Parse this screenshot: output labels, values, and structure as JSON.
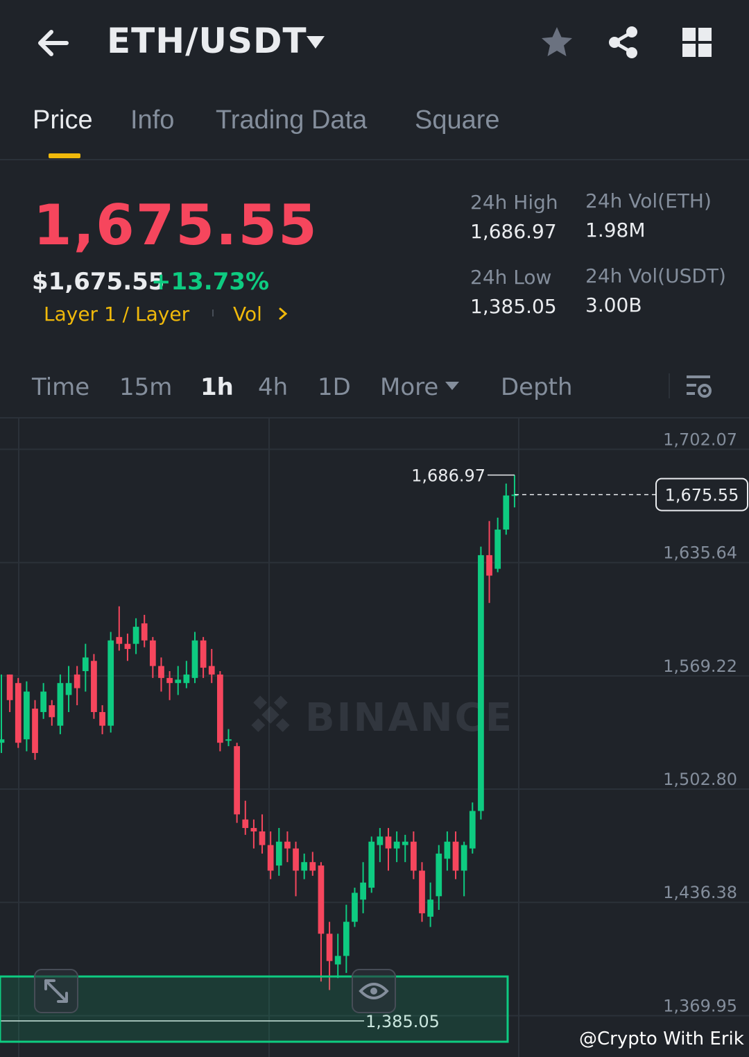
{
  "header": {
    "pair": "ETH/USDT"
  },
  "tabs": [
    {
      "label": "Price",
      "active": true
    },
    {
      "label": "Info",
      "active": false
    },
    {
      "label": "Trading Data",
      "active": false
    },
    {
      "label": "Square",
      "active": false
    }
  ],
  "price": {
    "last": "1,675.55",
    "usd": "$1,675.55",
    "change_pct": "+13.73%",
    "tag": "Layer 1 / Layer",
    "vol_tag": "Vol"
  },
  "stats": {
    "high_label": "24h High",
    "high_value": "1,686.97",
    "low_label": "24h Low",
    "low_value": "1,385.05",
    "vol_eth_label": "24h Vol(ETH)",
    "vol_eth_value": "1.98M",
    "vol_usdt_label": "24h Vol(USDT)",
    "vol_usdt_value": "3.00B"
  },
  "intervals": [
    {
      "label": "Time",
      "active": false
    },
    {
      "label": "15m",
      "active": false
    },
    {
      "label": "1h",
      "active": true
    },
    {
      "label": "4h",
      "active": false
    },
    {
      "label": "1D",
      "active": false
    },
    {
      "label": "More",
      "active": false
    },
    {
      "label": "Depth",
      "active": false
    }
  ],
  "colors": {
    "up": "#0ecb81",
    "down": "#f6465d",
    "accent": "#f0b90b",
    "background": "#1f2329"
  },
  "watermark": "@Crypto With Erik",
  "chart_data": {
    "type": "candlestick",
    "price_axis_labels": [
      "1,702.07",
      "1,635.64",
      "1,569.22",
      "1,502.80",
      "1,436.38",
      "1,369.95"
    ],
    "current_price_label": "1,675.55",
    "current_price": 1675.55,
    "high_marker": {
      "label": "1,686.97",
      "value": 1686.97
    },
    "low_marker": {
      "label": "1,385.05",
      "value": 1385.05
    },
    "watermark_text": "BINANCE",
    "ylim": [
      1362,
      1712
    ],
    "grid": true,
    "candles": [
      [
        1530,
        1532,
        1570,
        1524
      ],
      [
        1570,
        1555,
        1570,
        1548
      ],
      [
        1565,
        1530,
        1568,
        1527
      ],
      [
        1532,
        1560,
        1566,
        1525
      ],
      [
        1550,
        1524,
        1555,
        1520
      ],
      [
        1548,
        1560,
        1565,
        1544
      ],
      [
        1552,
        1545,
        1555,
        1540
      ],
      [
        1540,
        1565,
        1570,
        1535
      ],
      [
        1558,
        1565,
        1575,
        1548
      ],
      [
        1570,
        1562,
        1575,
        1552
      ],
      [
        1572,
        1580,
        1588,
        1560
      ],
      [
        1578,
        1548,
        1582,
        1544
      ],
      [
        1548,
        1540,
        1552,
        1535
      ],
      [
        1540,
        1590,
        1595,
        1536
      ],
      [
        1592,
        1588,
        1610,
        1584
      ],
      [
        1588,
        1585,
        1594,
        1578
      ],
      [
        1588,
        1598,
        1603,
        1582
      ],
      [
        1600,
        1590,
        1605,
        1586
      ],
      [
        1590,
        1575,
        1592,
        1568
      ],
      [
        1575,
        1568,
        1580,
        1560
      ],
      [
        1568,
        1565,
        1572,
        1555
      ],
      [
        1565,
        1567,
        1575,
        1558
      ],
      [
        1565,
        1570,
        1578,
        1562
      ],
      [
        1568,
        1590,
        1595,
        1565
      ],
      [
        1590,
        1574,
        1592,
        1568
      ],
      [
        1575,
        1570,
        1585,
        1565
      ],
      [
        1570,
        1530,
        1572,
        1525
      ],
      [
        1532,
        1532,
        1538,
        1528
      ],
      [
        1528,
        1488,
        1530,
        1483
      ],
      [
        1485,
        1480,
        1496,
        1476
      ],
      [
        1480,
        1478,
        1485,
        1468
      ],
      [
        1478,
        1470,
        1488,
        1465
      ],
      [
        1470,
        1455,
        1478,
        1450
      ],
      [
        1458,
        1472,
        1480,
        1452
      ],
      [
        1472,
        1468,
        1478,
        1460
      ],
      [
        1468,
        1455,
        1472,
        1440
      ],
      [
        1455,
        1460,
        1465,
        1450
      ],
      [
        1460,
        1455,
        1466,
        1452
      ],
      [
        1458,
        1418,
        1460,
        1390
      ],
      [
        1418,
        1402,
        1425,
        1385
      ],
      [
        1400,
        1405,
        1418,
        1392
      ],
      [
        1405,
        1425,
        1435,
        1395
      ],
      [
        1425,
        1442,
        1445,
        1422
      ],
      [
        1438,
        1448,
        1460,
        1430
      ],
      [
        1445,
        1472,
        1475,
        1442
      ],
      [
        1470,
        1475,
        1480,
        1460
      ],
      [
        1475,
        1468,
        1480,
        1455
      ],
      [
        1468,
        1472,
        1478,
        1460
      ],
      [
        1470,
        1472,
        1476,
        1460
      ],
      [
        1472,
        1455,
        1478,
        1450
      ],
      [
        1455,
        1430,
        1460,
        1425
      ],
      [
        1428,
        1438,
        1448,
        1422
      ],
      [
        1440,
        1465,
        1470,
        1432
      ],
      [
        1462,
        1472,
        1478,
        1455
      ],
      [
        1472,
        1455,
        1478,
        1450
      ],
      [
        1455,
        1470,
        1472,
        1440
      ],
      [
        1468,
        1490,
        1495,
        1465
      ],
      [
        1490,
        1640,
        1645,
        1485
      ],
      [
        1640,
        1628,
        1660,
        1612
      ],
      [
        1632,
        1655,
        1662,
        1630
      ],
      [
        1655,
        1675,
        1682,
        1652
      ],
      [
        1675,
        1675.55,
        1686.97,
        1668
      ]
    ]
  }
}
